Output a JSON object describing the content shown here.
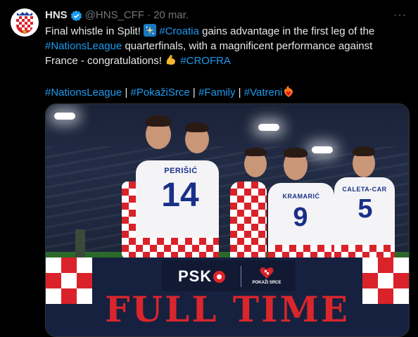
{
  "tweet": {
    "author_name": "HNS",
    "handle": "@HNS_CFF",
    "separator": "·",
    "time": "20 mar.",
    "more_label": "···",
    "line1_text": "Final whistle in Split!",
    "line1_hashtag": "#Croatia",
    "line1_rest": "gains advantage in the first leg of the",
    "line2_hashtag": "#NationsLeague",
    "line2_rest": "quarterfinals, with a magnificent performance against",
    "line3_text": "France - congratulations!",
    "line3_hashtag": "#CROFRA",
    "tags": [
      "#NationsLeague",
      "#PokažiSrce",
      "#Family",
      "#Vatreni"
    ],
    "tag_separator": "|"
  },
  "media": {
    "players": [
      {
        "name": "PERIŠIĆ",
        "number": "14"
      },
      {
        "name": "KRAMARIĆ",
        "number": "9"
      },
      {
        "name": "CALETA-CAR",
        "number": "5"
      }
    ],
    "sponsor_logo": "PSK",
    "campaign_label": "POKAŽI SRCE",
    "headline": "FULL TIME"
  },
  "colors": {
    "background": "#000000",
    "text": "#e7e9ea",
    "muted": "#71767b",
    "link": "#1d9bf0",
    "croatia_red": "#d9222a",
    "banner_navy": "#15213f"
  },
  "icons": [
    "hns-crest-icon",
    "verified-badge-icon",
    "sparkle-emoji",
    "muscle-emoji",
    "fire-heart-emoji"
  ]
}
